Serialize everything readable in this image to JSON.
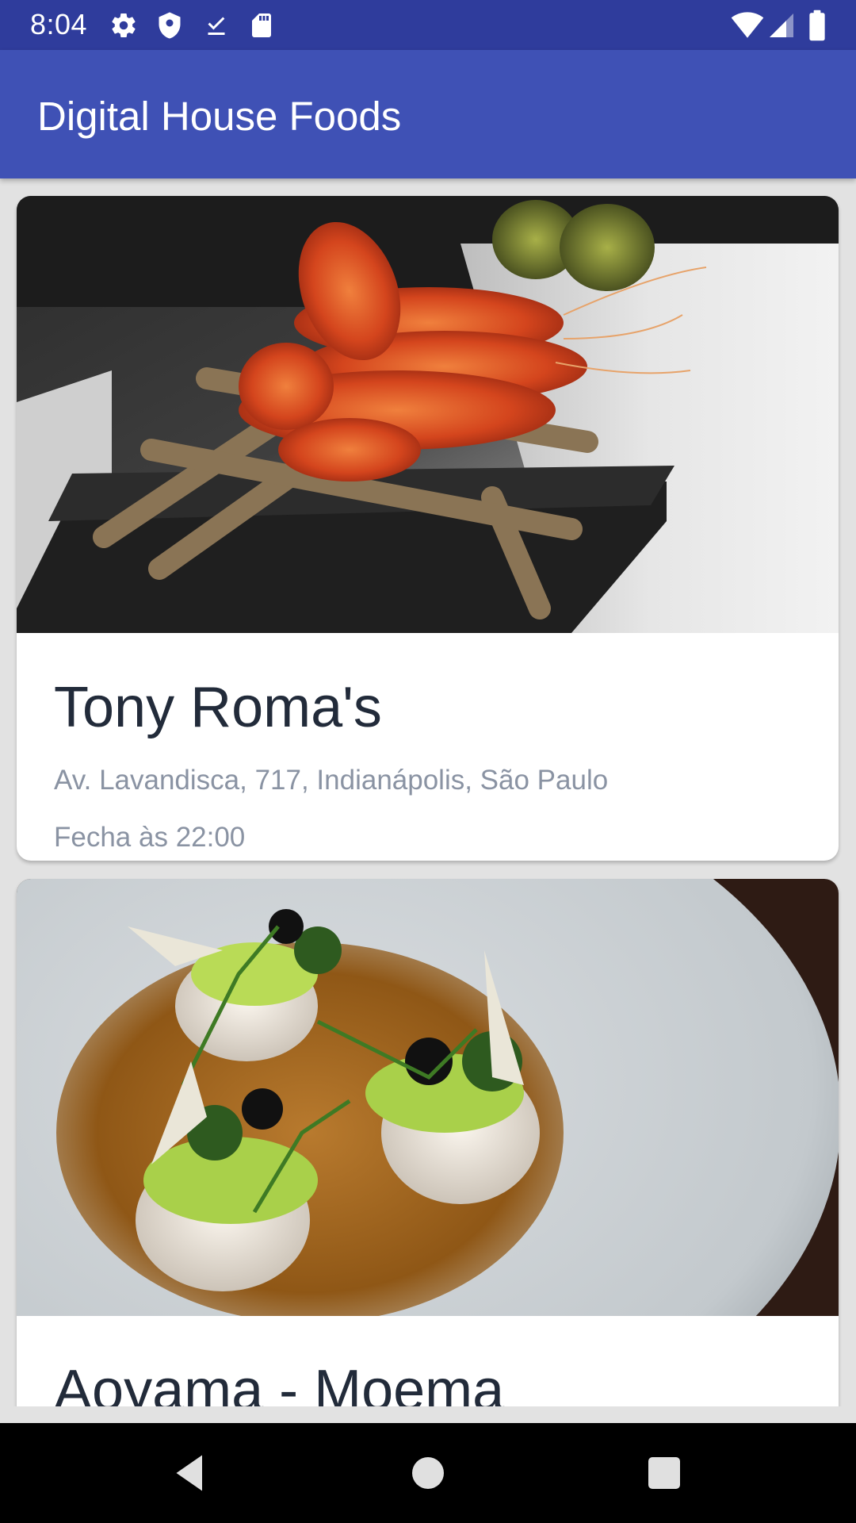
{
  "status_bar": {
    "time": "8:04",
    "left_icons": [
      "gear-icon",
      "shield-icon",
      "download-done-icon",
      "sd-card-icon"
    ],
    "right_icons": [
      "wifi-icon",
      "signal-icon",
      "battery-icon"
    ]
  },
  "app_bar": {
    "title": "Digital House Foods",
    "color": "#3f51b5",
    "status_color": "#2f3c9c"
  },
  "restaurants": [
    {
      "name": "Tony Roma's",
      "address": "Av. Lavandisca, 717, Indianápolis, São Paulo",
      "hours": "Fecha às 22:00"
    },
    {
      "name": "Aoyama - Moema"
    }
  ],
  "nav_bar": {
    "buttons": [
      "back-icon",
      "home-icon",
      "recents-icon"
    ]
  }
}
